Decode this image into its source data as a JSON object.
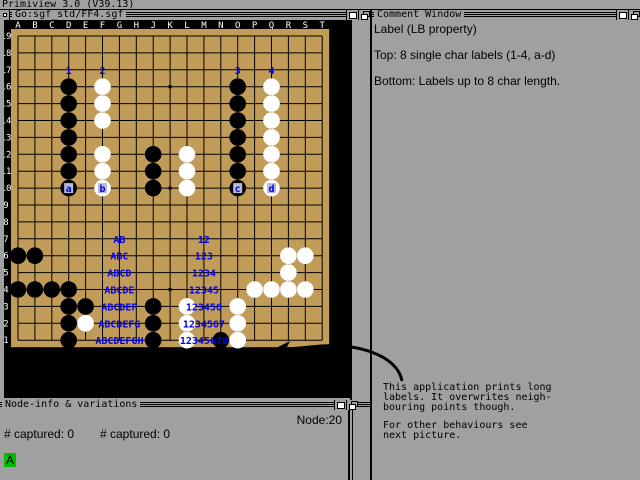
{
  "screen": {
    "title": "Primiview 3.0 (V39.13)"
  },
  "board_window": {
    "title": "Go:sgf_std/FF4.sgf",
    "columns": [
      "A",
      "B",
      "C",
      "D",
      "E",
      "F",
      "G",
      "H",
      "J",
      "K",
      "L",
      "M",
      "N",
      "O",
      "P",
      "Q",
      "R",
      "S",
      "T"
    ],
    "rows": [
      "19",
      "18",
      "17",
      "16",
      "15",
      "14",
      "13",
      "12",
      "11",
      "10",
      "9",
      "8",
      "7",
      "6",
      "5",
      "4",
      "3",
      "2",
      "1"
    ],
    "black_stones": [
      "D16",
      "D15",
      "D14",
      "D13",
      "D12",
      "D11",
      "D10",
      "O16",
      "O15",
      "O14",
      "O13",
      "O12",
      "O11",
      "O10",
      "J12",
      "J11",
      "J10",
      "A6",
      "B6",
      "A4",
      "B4",
      "C4",
      "D4",
      "D3",
      "D2",
      "D1",
      "E3",
      "J3",
      "J2",
      "J1",
      "N1"
    ],
    "white_stones": [
      "F16",
      "F15",
      "F14",
      "F12",
      "F11",
      "F10",
      "L12",
      "L11",
      "L10",
      "Q16",
      "Q15",
      "Q14",
      "Q13",
      "Q12",
      "Q11",
      "Q10",
      "R6",
      "S6",
      "R5",
      "P4",
      "Q4",
      "R4",
      "S4",
      "O3",
      "E2",
      "L3",
      "L2",
      "L1",
      "O2",
      "O1"
    ],
    "labels_top": [
      {
        "point": "D10",
        "text": "a"
      },
      {
        "point": "F10",
        "text": "b"
      },
      {
        "point": "O10",
        "text": "c"
      },
      {
        "point": "Q10",
        "text": "d"
      },
      {
        "point": "D17",
        "text": "1"
      },
      {
        "point": "F17",
        "text": "2"
      },
      {
        "point": "O17",
        "text": "3"
      },
      {
        "point": "Q17",
        "text": "4"
      }
    ],
    "labels_bottom": [
      {
        "point": "G7",
        "text": "AB"
      },
      {
        "point": "G6",
        "text": "ABC"
      },
      {
        "point": "G5",
        "text": "ABCD"
      },
      {
        "point": "G4",
        "text": "ABCDE"
      },
      {
        "point": "G3",
        "text": "ABCDEF"
      },
      {
        "point": "G2",
        "text": "ABCDEFG"
      },
      {
        "point": "G1",
        "text": "ABCDEFGH"
      },
      {
        "point": "M7",
        "text": "12"
      },
      {
        "point": "M6",
        "text": "123"
      },
      {
        "point": "M5",
        "text": "1234"
      },
      {
        "point": "M4",
        "text": "12345"
      },
      {
        "point": "M3",
        "text": "123456"
      },
      {
        "point": "M2",
        "text": "1234567"
      },
      {
        "point": "M1",
        "text": "12345678"
      }
    ],
    "colors": {
      "board": "#c09c58",
      "label": "#0000ee",
      "line": "#000000"
    }
  },
  "comment_window": {
    "title": "Comment Window",
    "lines": [
      "Label (LB property)",
      "Top: 8 single char labels (1-4, a-d)",
      "Bottom: Labels up to 8 char length."
    ],
    "annotation": [
      "This application prints long",
      "labels. It overwrites neigh-",
      "bouring points though.",
      "For other behaviours see",
      "next picture."
    ]
  },
  "node_window": {
    "title": "Node-info & variations",
    "node_label": "Node:20",
    "captured_black": "# captured: 0",
    "captured_white": "# captured: 0",
    "variation": "A"
  }
}
